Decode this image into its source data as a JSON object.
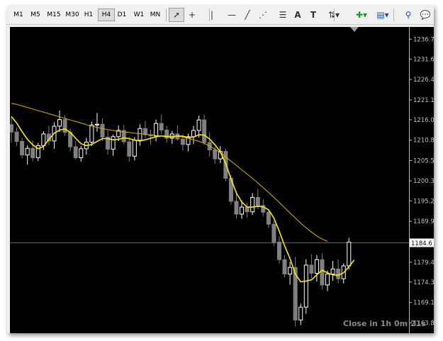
{
  "toolbar": {
    "timeframes": [
      {
        "label": "M1",
        "active": false
      },
      {
        "label": "M5",
        "active": false
      },
      {
        "label": "M15",
        "active": false
      },
      {
        "label": "M30",
        "active": false
      },
      {
        "label": "H1",
        "active": false
      },
      {
        "label": "H4",
        "active": true
      },
      {
        "label": "D1",
        "active": false
      },
      {
        "label": "W1",
        "active": false
      },
      {
        "label": "MN",
        "active": false
      }
    ],
    "tools": [
      {
        "name": "cursor-icon",
        "glyph": "➚",
        "active": true
      },
      {
        "name": "crosshair-icon",
        "glyph": "+",
        "active": false
      },
      {
        "name": "vertical-line-icon",
        "glyph": "|",
        "active": false
      },
      {
        "name": "horizontal-line-icon",
        "glyph": "—",
        "active": false
      },
      {
        "name": "trendline-icon",
        "glyph": "╱",
        "active": false
      },
      {
        "name": "equidistant-channel-icon",
        "glyph": "⋰",
        "active": false
      },
      {
        "name": "fibonacci-retracement-icon",
        "glyph": "☰",
        "active": false
      },
      {
        "name": "text-icon",
        "glyph": "A",
        "active": false
      },
      {
        "name": "text-label-icon",
        "glyph": "T",
        "active": false
      },
      {
        "name": "arrows-dropdown-icon",
        "glyph": "⇅▾",
        "active": false
      },
      {
        "name": "new-chart-icon",
        "glyph": "✚▾",
        "active": false
      },
      {
        "name": "templates-icon",
        "glyph": "▤▾",
        "active": false
      },
      {
        "name": "search-icon",
        "glyph": "⚲",
        "active": false
      },
      {
        "name": "chat-icon",
        "glyph": "💬",
        "active": false
      }
    ]
  },
  "chart_data": {
    "type": "candlestick",
    "ylim": [
      1161.2,
      1239.9
    ],
    "y_ticks": [
      "1236.75",
      "1231.65",
      "1226.40",
      "1221.15",
      "1216.05",
      "1210.80",
      "1205.55",
      "1200.35",
      "1195.20",
      "1189.95",
      "1179.45",
      "1174.35",
      "1169.10",
      "1163.85"
    ],
    "current_price": "1184.6",
    "bid_line_value": 1184.6,
    "colors": {
      "background": "#000000",
      "axis": "#c0c0c0",
      "bull": "#ffffff",
      "bear": "#808080",
      "fast_ma": "#ffe800",
      "slow_ma": "#d8b000",
      "bid_line": "#606060"
    },
    "candles": [
      [
        1214.8,
        1216.6,
        1210.2,
        1212.9
      ],
      [
        1212.9,
        1214.1,
        1209.3,
        1210.5
      ],
      [
        1210.5,
        1211.4,
        1206.1,
        1207.0
      ],
      [
        1207.0,
        1209.5,
        1204.5,
        1208.7
      ],
      [
        1208.7,
        1210.7,
        1205.4,
        1206.3
      ],
      [
        1206.3,
        1210.1,
        1205.4,
        1209.4
      ],
      [
        1209.4,
        1213.1,
        1208.3,
        1212.4
      ],
      [
        1212.4,
        1214.5,
        1209.5,
        1210.6
      ],
      [
        1210.6,
        1215.4,
        1208.6,
        1214.4
      ],
      [
        1214.4,
        1218.4,
        1212.9,
        1216.1
      ],
      [
        1216.1,
        1217.2,
        1211.9,
        1212.8
      ],
      [
        1212.8,
        1213.8,
        1208.0,
        1209.1
      ],
      [
        1209.1,
        1210.6,
        1205.8,
        1206.3
      ],
      [
        1206.3,
        1209.3,
        1205.3,
        1208.6
      ],
      [
        1208.6,
        1211.4,
        1207.1,
        1210.3
      ],
      [
        1210.3,
        1215.6,
        1209.3,
        1214.7
      ],
      [
        1214.7,
        1217.8,
        1213.0,
        1214.9
      ],
      [
        1214.9,
        1216.4,
        1210.6,
        1211.6
      ],
      [
        1211.6,
        1213.3,
        1207.1,
        1208.5
      ],
      [
        1208.5,
        1212.2,
        1206.8,
        1211.7
      ],
      [
        1211.7,
        1214.6,
        1210.6,
        1213.3
      ],
      [
        1213.3,
        1214.7,
        1209.7,
        1210.4
      ],
      [
        1210.4,
        1211.6,
        1205.3,
        1206.7
      ],
      [
        1206.7,
        1211.6,
        1205.6,
        1210.8
      ],
      [
        1210.8,
        1214.9,
        1209.4,
        1213.8
      ],
      [
        1213.8,
        1215.7,
        1211.4,
        1212.2
      ],
      [
        1212.2,
        1213.5,
        1209.6,
        1211.9
      ],
      [
        1211.9,
        1216.1,
        1210.5,
        1215.1
      ],
      [
        1215.1,
        1217.4,
        1212.3,
        1213.4
      ],
      [
        1213.4,
        1214.4,
        1210.2,
        1211.3
      ],
      [
        1211.3,
        1213.2,
        1209.9,
        1212.4
      ],
      [
        1212.4,
        1214.6,
        1210.7,
        1211.1
      ],
      [
        1211.1,
        1212.3,
        1208.1,
        1209.7
      ],
      [
        1209.7,
        1212.5,
        1207.9,
        1211.7
      ],
      [
        1211.7,
        1214.5,
        1209.8,
        1213.3
      ],
      [
        1213.3,
        1217.1,
        1211.5,
        1216.0
      ],
      [
        1216.0,
        1217.3,
        1209.6,
        1210.2
      ],
      [
        1210.2,
        1212.8,
        1206.6,
        1208.3
      ],
      [
        1208.3,
        1209.1,
        1204.7,
        1206.0
      ],
      [
        1206.0,
        1209.3,
        1204.9,
        1207.9
      ],
      [
        1207.9,
        1208.6,
        1200.2,
        1201.0
      ],
      [
        1201.0,
        1201.8,
        1194.2,
        1195.1
      ],
      [
        1195.1,
        1197.6,
        1190.7,
        1191.8
      ],
      [
        1191.8,
        1195.3,
        1190.6,
        1193.6
      ],
      [
        1193.6,
        1194.8,
        1190.9,
        1192.4
      ],
      [
        1192.4,
        1197.2,
        1191.6,
        1196.1
      ],
      [
        1196.1,
        1198.3,
        1193.1,
        1194.0
      ],
      [
        1194.0,
        1195.6,
        1191.3,
        1192.3
      ],
      [
        1192.3,
        1193.1,
        1188.3,
        1189.2
      ],
      [
        1189.2,
        1190.1,
        1183.7,
        1184.6
      ],
      [
        1184.6,
        1186.1,
        1179.1,
        1180.1
      ],
      [
        1180.1,
        1181.3,
        1175.6,
        1176.4
      ],
      [
        1176.4,
        1179.5,
        1173.7,
        1178.1
      ],
      [
        1178.1,
        1180.8,
        1162.9,
        1164.6
      ],
      [
        1164.6,
        1168.8,
        1163.3,
        1167.9
      ],
      [
        1167.9,
        1180.2,
        1166.2,
        1178.7
      ],
      [
        1178.7,
        1181.5,
        1175.3,
        1176.6
      ],
      [
        1176.6,
        1181.3,
        1174.5,
        1180.1
      ],
      [
        1180.1,
        1181.7,
        1172.4,
        1173.6
      ],
      [
        1173.6,
        1177.3,
        1172.0,
        1176.4
      ],
      [
        1176.4,
        1179.8,
        1174.6,
        1177.7
      ],
      [
        1177.7,
        1180.2,
        1174.0,
        1175.2
      ],
      [
        1175.2,
        1179.1,
        1174.0,
        1178.5
      ],
      [
        1178.5,
        1185.7,
        1177.6,
        1184.6
      ]
    ],
    "fast_ma": [
      1216.9,
      1215.2,
      1213.0,
      1211.0,
      1209.6,
      1208.6,
      1209.2,
      1211.0,
      1212.6,
      1213.4,
      1213.7,
      1212.8,
      1211.3,
      1209.9,
      1209.4,
      1209.7,
      1210.5,
      1211.2,
      1211.2,
      1210.9,
      1211.0,
      1211.4,
      1211.2,
      1210.8,
      1210.6,
      1210.9,
      1211.3,
      1211.7,
      1211.9,
      1211.7,
      1211.6,
      1211.9,
      1211.8,
      1211.5,
      1211.6,
      1212.2,
      1212.1,
      1211.1,
      1209.6,
      1207.8,
      1204.8,
      1200.8,
      1197.2,
      1194.9,
      1193.6,
      1193.6,
      1193.8,
      1193.7,
      1192.9,
      1190.8,
      1187.4,
      1183.6,
      1180.4,
      1176.4,
      1174.4,
      1174.6,
      1174.9,
      1176.2,
      1177.4,
      1176.7,
      1176.2,
      1176.1,
      1176.7,
      1178.3,
      1180.0
    ],
    "slow_ma": [
      1220.3,
      1220.0,
      1219.6,
      1219.2,
      1218.8,
      1218.4,
      1218.0,
      1217.6,
      1217.2,
      1216.8,
      1216.4,
      1216.0,
      1215.6,
      1215.2,
      1214.8,
      1214.4,
      1214.1,
      1213.8,
      1213.5,
      1213.3,
      1213.1,
      1212.9,
      1212.8,
      1212.6,
      1212.5,
      1212.3,
      1212.2,
      1212.0,
      1211.9,
      1211.9,
      1211.9,
      1211.8,
      1211.6,
      1211.3,
      1210.9,
      1210.5,
      1210.0,
      1209.3,
      1208.5,
      1207.6,
      1206.5,
      1205.4,
      1204.3,
      1203.2,
      1202.1,
      1201.0,
      1199.8,
      1198.6,
      1197.4,
      1196.1,
      1194.8,
      1193.4,
      1192.1,
      1190.8,
      1189.5,
      1188.3,
      1187.2,
      1186.2,
      1185.4,
      1184.8
    ],
    "countdown": "Close in 1h 0m 21s"
  }
}
